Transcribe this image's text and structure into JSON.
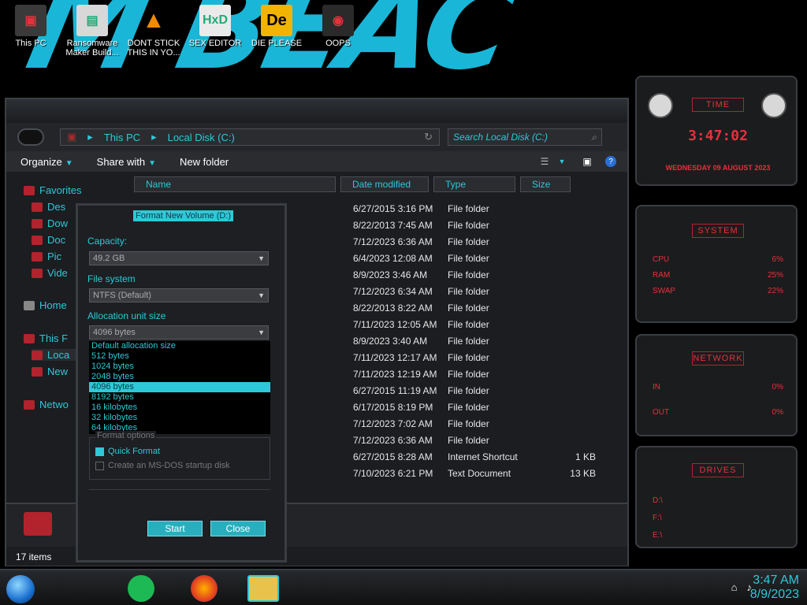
{
  "desktop": {
    "icons": [
      {
        "label": "This PC",
        "icon": "computer-icon",
        "color": "#444"
      },
      {
        "label": "Ransomware Maker Build...",
        "icon": "app-window-icon",
        "color": "#d8d8d8"
      },
      {
        "label": "DONT STICK THIS IN YO...",
        "icon": "vlc-cone-icon",
        "color": "#f08a00"
      },
      {
        "label": "SEX EDITOR",
        "icon": "hxd-editor-icon",
        "color": "#eaeaea"
      },
      {
        "label": "DIE PLEASE",
        "icon": "die-icon",
        "color": "#f2b400"
      },
      {
        "label": "OOPS",
        "icon": "app-icon",
        "color": "#333"
      }
    ]
  },
  "explorer": {
    "address": {
      "crumbs": [
        "This PC",
        "Local Disk (C:)"
      ],
      "placeholder": "Search Local Disk (C:)"
    },
    "toolbar": {
      "organize": "Organize",
      "share": "Share with",
      "newfolder": "New folder"
    },
    "nav": {
      "favorites": "Favorites",
      "desktop": "Des",
      "downloads": "Dow",
      "documents": "Doc",
      "pictures": "Pic",
      "videos": "Vide",
      "home": "Home",
      "thispc": "This F",
      "local": "Loca",
      "newvol": "New",
      "network": "Netwo"
    },
    "columns": {
      "name": "Name",
      "date": "Date modified",
      "type": "Type",
      "size": "Size"
    },
    "files": [
      {
        "date": "6/27/2015 3:16 PM",
        "type": "File folder",
        "size": ""
      },
      {
        "date": "8/22/2013 7:45 AM",
        "type": "File folder",
        "size": ""
      },
      {
        "date": "7/12/2023 6:36 AM",
        "type": "File folder",
        "size": ""
      },
      {
        "date": "6/4/2023 12:08 AM",
        "type": "File folder",
        "size": ""
      },
      {
        "date": "8/9/2023 3:46 AM",
        "type": "File folder",
        "size": ""
      },
      {
        "date": "7/12/2023 6:34 AM",
        "type": "File folder",
        "size": ""
      },
      {
        "date": "8/22/2013 8:22 AM",
        "type": "File folder",
        "size": ""
      },
      {
        "date": "7/11/2023 12:05 AM",
        "type": "File folder",
        "size": ""
      },
      {
        "date": "8/9/2023 3:40 AM",
        "type": "File folder",
        "size": ""
      },
      {
        "date": "7/11/2023 12:17 AM",
        "type": "File folder",
        "size": ""
      },
      {
        "date": "7/11/2023 12:19 AM",
        "type": "File folder",
        "size": ""
      },
      {
        "date": "6/27/2015 11:19 AM",
        "type": "File folder",
        "size": ""
      },
      {
        "date": "6/17/2015 8:19 PM",
        "type": "File folder",
        "size": ""
      },
      {
        "date": "7/12/2023 7:02 AM",
        "type": "File folder",
        "size": ""
      },
      {
        "date": "7/12/2023 6:36 AM",
        "type": "File folder",
        "size": ""
      },
      {
        "date": "6/27/2015 8:28 AM",
        "type": "Internet Shortcut",
        "size": "1 KB"
      },
      {
        "date": "7/10/2023 6:21 PM",
        "type": "Text Document",
        "size": "13 KB"
      }
    ],
    "status": "17 items"
  },
  "format_dialog": {
    "title": "Format New Volume (D:)",
    "capacity_label": "Capacity:",
    "capacity_value": "49.2 GB",
    "fs_label": "File system",
    "fs_value": "NTFS (Default)",
    "alloc_label": "Allocation unit size",
    "alloc_value": "4096 bytes",
    "alloc_options": [
      "Default allocation size",
      "512 bytes",
      "1024 bytes",
      "2048 bytes",
      "4096 bytes",
      "8192 bytes",
      "16 kilobytes",
      "32 kilobytes",
      "64 kilobytes"
    ],
    "selected_index": 4,
    "options_label": "Format options",
    "quick_format": "Quick Format",
    "msdos": "Create an MS-DOS startup disk",
    "start": "Start",
    "close": "Close"
  },
  "gadgets": {
    "time_title": "TIME",
    "time_value": "3:47:02",
    "date_value": "WEDNESDAY 09 AUGUST 2023",
    "system_title": "SYSTEM",
    "cpu_label": "CPU",
    "cpu_value": "6%",
    "ram_label": "RAM",
    "ram_value": "25%",
    "swap_label": "SWAP",
    "swap_value": "22%",
    "network_title": "NETWORK",
    "in_label": "IN",
    "in_value": "0%",
    "out_label": "OUT",
    "out_value": "0%",
    "drives_title": "DRIVES",
    "drive_d": "D:\\",
    "drive_f": "F:\\",
    "drive_e": "E:\\"
  },
  "taskbar": {
    "time": "3:47 AM",
    "date": "8/9/2023"
  },
  "colors": {
    "accent": "#2ec9d8",
    "alert": "#e8303c"
  }
}
